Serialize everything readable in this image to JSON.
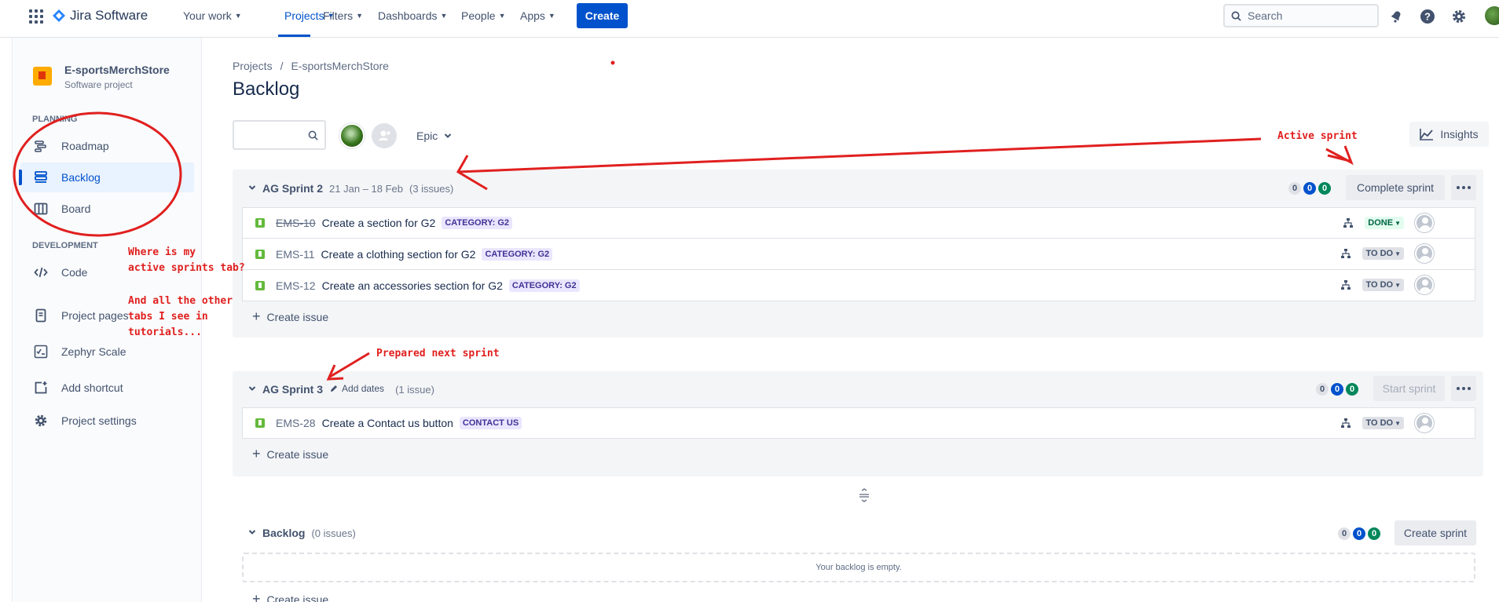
{
  "topnav": {
    "app_name": "Jira Software",
    "items": [
      {
        "label": "Your work"
      },
      {
        "label": "Projects"
      },
      {
        "label": "Filters"
      },
      {
        "label": "Dashboards"
      },
      {
        "label": "People"
      },
      {
        "label": "Apps"
      }
    ],
    "create_label": "Create",
    "search_placeholder": "Search",
    "accent": "#0052cc"
  },
  "sidebar": {
    "project_name": "E-sportsMerchStore",
    "project_type": "Software project",
    "planning_label": "PLANNING",
    "development_label": "DEVELOPMENT",
    "items": [
      {
        "label": "Roadmap",
        "icon": "roadmap-icon"
      },
      {
        "label": "Backlog",
        "icon": "backlog-icon"
      },
      {
        "label": "Board",
        "icon": "board-icon"
      },
      {
        "label": "Code",
        "icon": "code-icon"
      },
      {
        "label": "Project pages",
        "icon": "pages-icon"
      },
      {
        "label": "Zephyr Scale",
        "icon": "zephyr-icon"
      },
      {
        "label": "Add shortcut",
        "icon": "add-shortcut-icon"
      },
      {
        "label": "Project settings",
        "icon": "gear-icon"
      }
    ]
  },
  "main": {
    "breadcrumb": [
      "Projects",
      "/",
      "E-sportsMerchStore"
    ],
    "title": "Backlog",
    "epic_label": "Epic",
    "insights_label": "Insights"
  },
  "sprints": [
    {
      "name": "AG Sprint 2",
      "dates": "21 Jan – 18 Feb",
      "issue_count": "(3 issues)",
      "counts": [
        "0",
        "0",
        "0"
      ],
      "action": "Complete sprint",
      "issues": [
        {
          "key": "EMS-10",
          "summary": "Create a section for G2",
          "label": "CATEGORY: G2",
          "status": "DONE"
        },
        {
          "key": "EMS-11",
          "summary": "Create a clothing section for G2",
          "label": "CATEGORY: G2",
          "status": "TO DO"
        },
        {
          "key": "EMS-12",
          "summary": "Create an accessories section for G2",
          "label": "CATEGORY: G2",
          "status": "TO DO"
        }
      ],
      "create_issue": "Create issue"
    },
    {
      "name": "AG Sprint 3",
      "dates": "Add dates",
      "issue_count": "(1 issue)",
      "counts": [
        "0",
        "0",
        "0"
      ],
      "action": "Start sprint",
      "issues": [
        {
          "key": "EMS-28",
          "summary": "Create a Contact us button",
          "label": "CONTACT US",
          "status": "TO DO"
        }
      ],
      "create_issue": "Create issue"
    }
  ],
  "backlog": {
    "name": "Backlog",
    "issue_count": "(0 issues)",
    "counts": [
      "0",
      "0",
      "0"
    ],
    "action": "Create sprint",
    "empty_text": "Your backlog is empty.",
    "create_issue": "Create issue"
  },
  "annotations": {
    "active_sprint": "Active sprint",
    "prepared_next": "Prepared next sprint",
    "question_1": "Where is my\nactive sprints tab?",
    "question_2": "And all the other\ntabs I see in\ntutorials...",
    "color": "#e0201f"
  }
}
